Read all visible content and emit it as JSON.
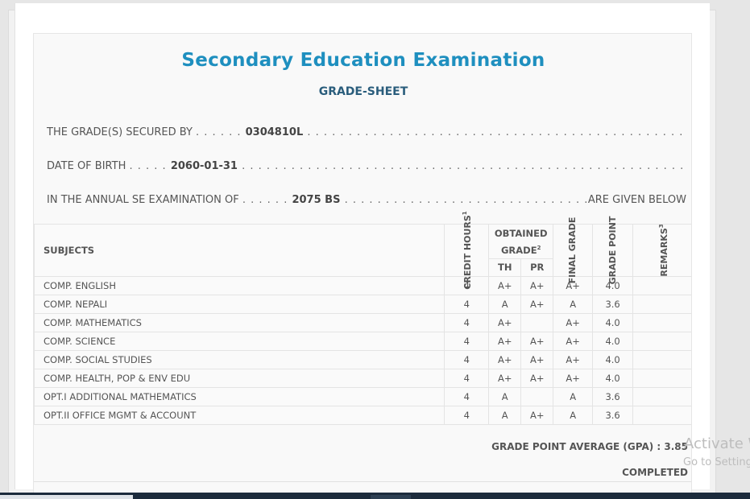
{
  "document": {
    "title": "Secondary Education Examination",
    "subtitle": "GRADE-SHEET",
    "secured_by_label": "THE GRADE(S) SECURED BY",
    "symbol_no": "0304810L",
    "dob_label": "DATE OF BIRTH",
    "dob": "2060-01-31",
    "exam_label": "IN THE ANNUAL SE EXAMINATION OF",
    "exam_year": "2075 BS",
    "given_below": "ARE GIVEN BELOW"
  },
  "table": {
    "headers": {
      "subjects": "SUBJECTS",
      "credit_hours": "CREDIT HOURS",
      "credit_sup": "1",
      "obtained_grade": "OBTAINED GRADE",
      "obtained_sup": "2",
      "th": "TH",
      "pr": "PR",
      "final_grade": "FINAL GRADE",
      "grade_point": "GRADE POINT",
      "remarks": "REMARKS",
      "remarks_sup": "3"
    },
    "rows": [
      {
        "subject": "COMP. ENGLISH",
        "credit": "4",
        "th": "A+",
        "pr": "A+",
        "final": "A+",
        "gp": "4.0",
        "remarks": ""
      },
      {
        "subject": "COMP. NEPALI",
        "credit": "4",
        "th": "A",
        "pr": "A+",
        "final": "A",
        "gp": "3.6",
        "remarks": ""
      },
      {
        "subject": "COMP. MATHEMATICS",
        "credit": "4",
        "th": "A+",
        "pr": "",
        "final": "A+",
        "gp": "4.0",
        "remarks": ""
      },
      {
        "subject": "COMP. SCIENCE",
        "credit": "4",
        "th": "A+",
        "pr": "A+",
        "final": "A+",
        "gp": "4.0",
        "remarks": ""
      },
      {
        "subject": "COMP. SOCIAL STUDIES",
        "credit": "4",
        "th": "A+",
        "pr": "A+",
        "final": "A+",
        "gp": "4.0",
        "remarks": ""
      },
      {
        "subject": "COMP. HEALTH, POP & ENV EDU",
        "credit": "4",
        "th": "A+",
        "pr": "A+",
        "final": "A+",
        "gp": "4.0",
        "remarks": ""
      },
      {
        "subject": "OPT.I ADDITIONAL MATHEMATICS",
        "credit": "4",
        "th": "A",
        "pr": "",
        "final": "A",
        "gp": "3.6",
        "remarks": ""
      },
      {
        "subject": "OPT.II OFFICE MGMT & ACCOUNT",
        "credit": "4",
        "th": "A",
        "pr": "A+",
        "final": "A",
        "gp": "3.6",
        "remarks": ""
      }
    ]
  },
  "summary": {
    "gpa_label": "GRADE POINT AVERAGE (GPA) :",
    "gpa_value": "3.85",
    "status": "COMPLETED"
  },
  "windows_watermark": {
    "line1": "Activate W",
    "line2": "Go to Setting"
  }
}
